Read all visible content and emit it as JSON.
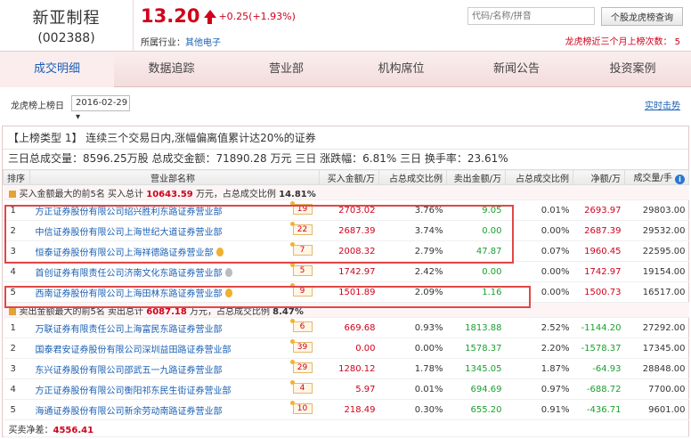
{
  "stock": {
    "name": "新亚制程",
    "code": "(002388)",
    "price": "13.20",
    "change": "+0.25(+1.93%)",
    "industry_label": "所属行业：",
    "industry_value": "其他电子"
  },
  "search": {
    "placeholder": "代码/名称/拼音",
    "button_label": "个股龙虎榜查询"
  },
  "rank_info": "龙虎榜近三个月上榜次数： 5",
  "tabs": [
    "成交明细",
    "数据追踪",
    "营业部",
    "机构席位",
    "新闻公告",
    "投资案例"
  ],
  "toolbar": {
    "label": "龙虎榜上榜日",
    "date": "2016-02-29 ▾",
    "realtime": "实时击势"
  },
  "type_title": "【上榜类型 1】 连续三个交易日内,涨幅偏离值累计达20%的证券",
  "summary": "三日总成交量：8596.25万股 总成交金额：71890.28 万元 三日 涨跌幅：6.81% 三日 换手率：23.61%",
  "columns": {
    "idx": "排序",
    "name": "营业部名称",
    "buy": "买入金额/万",
    "buy_pct": "占总成交比例",
    "sell": "卖出金额/万",
    "sell_pct": "占总成交比例",
    "net": "净额/万",
    "volume": "成交量/手"
  },
  "buy_section": {
    "prefix": "买入金额最大的前5名   买入总计",
    "total": "10643.59",
    "suffix": "万元，占总成交比例",
    "pct": "14.81%"
  },
  "buy_rows": [
    {
      "idx": "1",
      "name": "方正证券股份有限公司绍兴胜利东路证券营业部",
      "badge": "19",
      "medal": "",
      "buy": "2703.02",
      "buy_pct": "3.76%",
      "sell": "9.05",
      "sell_pct": "0.01%",
      "net": "2693.97",
      "volume": "29803.00"
    },
    {
      "idx": "2",
      "name": "中信证券股份有限公司上海世纪大道证券营业部",
      "badge": "22",
      "medal": "",
      "buy": "2687.39",
      "buy_pct": "3.74%",
      "sell": "0.00",
      "sell_pct": "0.00%",
      "net": "2687.39",
      "volume": "29532.00"
    },
    {
      "idx": "3",
      "name": "恒泰证券股份有限公司上海祥德路证券营业部",
      "badge": "7",
      "medal": "gold",
      "buy": "2008.32",
      "buy_pct": "2.79%",
      "sell": "47.87",
      "sell_pct": "0.07%",
      "net": "1960.45",
      "volume": "22595.00"
    },
    {
      "idx": "4",
      "name": "首创证券有限责任公司济南文化东路证券营业部",
      "badge": "5",
      "medal": "gray",
      "buy": "1742.97",
      "buy_pct": "2.42%",
      "sell": "0.00",
      "sell_pct": "0.00%",
      "net": "1742.97",
      "volume": "19154.00"
    },
    {
      "idx": "5",
      "name": "西南证券股份有限公司上海田林东路证券营业部",
      "badge": "9",
      "medal": "gold",
      "buy": "1501.89",
      "buy_pct": "2.09%",
      "sell": "1.16",
      "sell_pct": "0.00%",
      "net": "1500.73",
      "volume": "16517.00"
    }
  ],
  "sell_section": {
    "prefix": "卖出金额最大的前5名   卖出总计",
    "total": "6087.18",
    "suffix": "万元，占总成交比例",
    "pct": "8.47%"
  },
  "sell_rows": [
    {
      "idx": "1",
      "name": "万联证券有限责任公司上海富民东路证券营业部",
      "badge": "6",
      "medal": "",
      "buy": "669.68",
      "buy_pct": "0.93%",
      "sell": "1813.88",
      "sell_pct": "2.52%",
      "net": "-1144.20",
      "volume": "27292.00"
    },
    {
      "idx": "2",
      "name": "国泰君安证券股份有限公司深圳益田路证券营业部",
      "badge": "39",
      "medal": "",
      "buy": "0.00",
      "buy_pct": "0.00%",
      "sell": "1578.37",
      "sell_pct": "2.20%",
      "net": "-1578.37",
      "volume": "17345.00"
    },
    {
      "idx": "3",
      "name": "东兴证券股份有限公司邵武五一九路证券营业部",
      "badge": "29",
      "medal": "",
      "buy": "1280.12",
      "buy_pct": "1.78%",
      "sell": "1345.05",
      "sell_pct": "1.87%",
      "net": "-64.93",
      "volume": "28848.00"
    },
    {
      "idx": "4",
      "name": "方正证券股份有限公司衡阳祁东民生街证券营业部",
      "badge": "4",
      "medal": "",
      "buy": "5.97",
      "buy_pct": "0.01%",
      "sell": "694.69",
      "sell_pct": "0.97%",
      "net": "-688.72",
      "volume": "7700.00"
    },
    {
      "idx": "5",
      "name": "海通证券股份有限公司新余劳动南路证券营业部",
      "badge": "10",
      "medal": "",
      "buy": "218.49",
      "buy_pct": "0.30%",
      "sell": "655.20",
      "sell_pct": "0.91%",
      "net": "-436.71",
      "volume": "9601.00"
    }
  ],
  "footer": {
    "label": "买卖净差：",
    "value": "4556.41"
  },
  "colors": {
    "accent": "#d0021b",
    "link": "#1a5fb4",
    "positive": "#1a9f2e",
    "highlight": "#e04848"
  }
}
